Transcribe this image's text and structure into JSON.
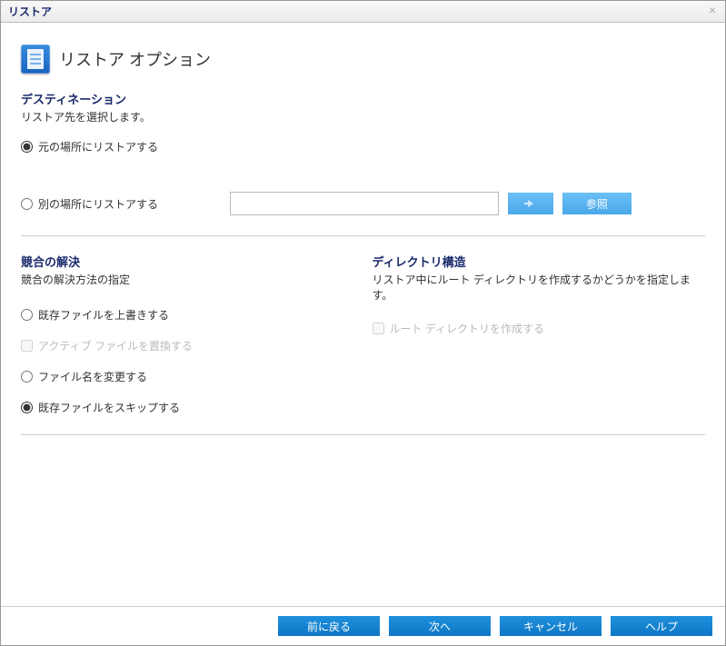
{
  "window": {
    "title": "リストア"
  },
  "heading": "リストア オプション",
  "destination": {
    "title": "デスティネーション",
    "desc": "リストア先を選択します。",
    "orig_label": "元の場所にリストアする",
    "alt_label": "別の場所にリストアする",
    "path_value": "",
    "browse_label": "参照",
    "selected": "orig"
  },
  "conflict": {
    "title": "競合の解決",
    "desc": "競合の解決方法の指定",
    "overwrite_label": "既存ファイルを上書きする",
    "replace_active_label": "アクティブ ファイルを置換する",
    "rename_label": "ファイル名を変更する",
    "skip_label": "既存ファイルをスキップする",
    "selected": "skip"
  },
  "dir_structure": {
    "title": "ディレクトリ構造",
    "desc": "リストア中にルート ディレクトリを作成するかどうかを指定します。",
    "create_root_label": "ルート ディレクトリを作成する",
    "create_root_checked": false
  },
  "footer": {
    "back": "前に戻る",
    "next": "次へ",
    "cancel": "キャンセル",
    "help": "ヘルプ"
  }
}
